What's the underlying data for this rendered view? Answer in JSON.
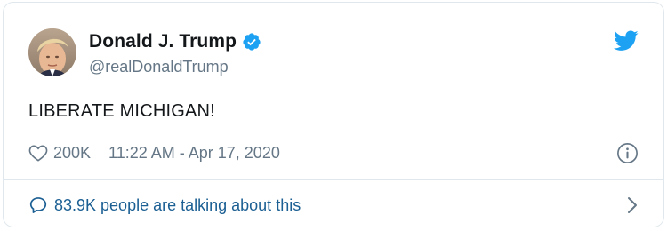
{
  "tweet": {
    "author": {
      "display_name": "Donald J. Trump",
      "handle": "@realDonaldTrump",
      "verified": true
    },
    "text": "LIBERATE MICHIGAN!",
    "likes": "200K",
    "timestamp": "11:22 AM - Apr 17, 2020",
    "conversation": "83.9K people are talking about this"
  },
  "icons": {
    "verified": "verified-badge-icon",
    "brand": "twitter-bird-icon",
    "like": "heart-icon",
    "info": "info-icon",
    "reply": "speech-bubble-icon",
    "chevron": "chevron-right-icon"
  },
  "colors": {
    "accent": "#1da1f2",
    "link": "#1b5f93",
    "muted": "#657786",
    "text": "#14171a",
    "border": "#e1e8ed"
  }
}
